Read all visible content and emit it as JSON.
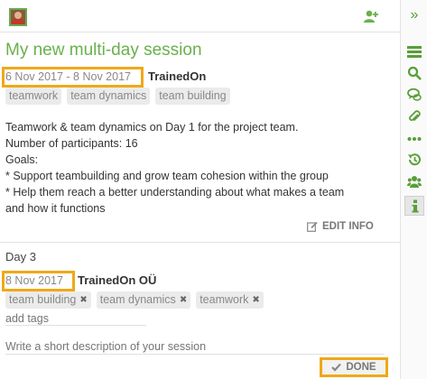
{
  "header": {
    "avatar_icon": "user-avatar",
    "add_user_icon": "add-user-icon"
  },
  "session": {
    "title": "My new multi-day session",
    "dates": "6 Nov 2017 - 8 Nov 2017",
    "organizer": "TrainedOn",
    "tags": [
      "teamwork",
      "team dynamics",
      "team building"
    ],
    "description": [
      "Teamwork & team dynamics on Day 1 for the project team.",
      "Number of participants: 16",
      "Goals:",
      "* Support teambuilding and grow team cohesion within the group",
      "* Help them reach a better understanding about what makes a team",
      "and how it functions"
    ],
    "edit_info_label": "EDIT INFO"
  },
  "day": {
    "label": "Day 3",
    "date": "8 Nov 2017",
    "organizer": "TrainedOn OÜ",
    "tags": [
      "team building",
      "team dynamics",
      "teamwork"
    ],
    "add_tags_placeholder": "add tags",
    "description_placeholder": "Write a short description of your session",
    "done_label": "DONE"
  },
  "sidebar": {
    "collapse_glyph": "»",
    "icons": [
      "list-icon",
      "search-icon",
      "comments-icon",
      "attachment-icon",
      "more-icon",
      "history-icon",
      "group-icon",
      "info-icon"
    ],
    "active": "info-icon"
  },
  "colors": {
    "accent_green": "#6ab04c",
    "highlight_orange": "#f0a818"
  }
}
